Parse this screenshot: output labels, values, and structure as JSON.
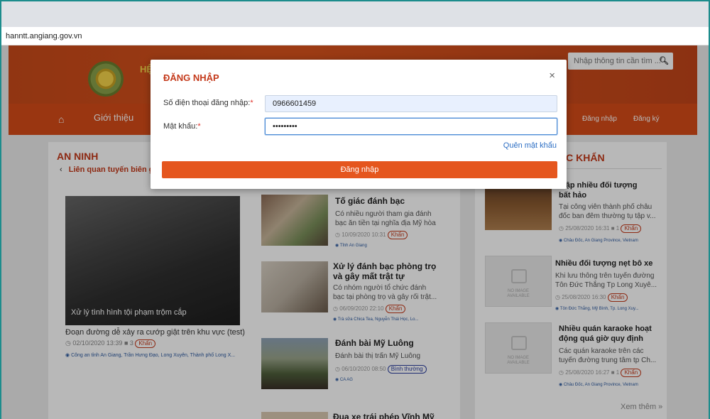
{
  "browser": {
    "url": "hanntt.angiang.gov.vn"
  },
  "header": {
    "title_fragment": "HỆ",
    "search_placeholder": "Nhập thông tin cần tìm ...",
    "search_icon": "search-icon"
  },
  "nav": {
    "home_icon": "home-icon",
    "intro": "Giới thiệu",
    "login": "Đăng nhập",
    "register": "Đăng ký"
  },
  "left": {
    "section": "AN NINH",
    "sub_prev": "‹",
    "sub_label": "Liên quan tuyến biên gi",
    "image_caption": "Xử lý tình hình tội phạm trộm cắp",
    "caption": "Đoạn đường dễ xảy ra cướp giật trên khu vực (test)",
    "meta_time": "02/10/2020 13:39",
    "meta_comments": "3",
    "badge": "Khẩn",
    "location": "Công an tỉnh An Giang, Trần Hưng Đạo, Long Xuyên, Thành phố Long X..."
  },
  "middle": {
    "articles": [
      {
        "title": "Tố giác đánh bạc",
        "desc1": "Có nhiều người tham gia đánh",
        "desc2": "bạc ăn tiền tại nghĩa địa Mỹ hòa",
        "meta": "10/09/2020 10:31",
        "badge": "Khẩn",
        "loc": "Tỉnh An Giang"
      },
      {
        "title": "Xử lý đánh bạc phòng trọ",
        "title2": "và gây mất trật tự",
        "desc1": "Có nhóm người tổ chức đánh",
        "desc2": "bạc tại phòng trọ và gây rối trật...",
        "meta": "06/09/2020 22:10",
        "badge": "Khẩn",
        "loc": "Trà sữa Chica Tea, Nguyễn Thái Học, Lo..."
      },
      {
        "title": "Đánh bài Mỹ Luông",
        "desc1": "Đánh bài thị trấn Mỹ Luông",
        "meta": "06/10/2020 08:50",
        "badge": "Bình thường",
        "loc": "CA AG"
      },
      {
        "title": "Đua xe trái phép Vĩnh Mỹ"
      }
    ]
  },
  "right": {
    "section": "ÁC KHẨN",
    "items": [
      {
        "title1": "i tập nhiều đối tượng",
        "title2": "bất hảo",
        "desc1": "Tại công viên thành phố châu",
        "desc2": "đốc ban đêm thường tụ tập v...",
        "meta": "25/08/2020 16:31",
        "comments": "1",
        "badge": "Khẩn",
        "loc": "Châu Đốc, An Giang Province, Vietnam"
      },
      {
        "title1": "Nhiều đối tượng nẹt bô xe",
        "desc1": "Khi lưu thông trên tuyến đường",
        "desc2": "Tôn Đức Thắng Tp Long Xuyê...",
        "meta": "25/08/2020 16:30",
        "badge": "Khẩn",
        "loc": "Tôn Đức Thắng, Mỹ Bình, Tp. Long Xuy..."
      },
      {
        "title1": "Nhiều quán karaoke hoạt",
        "title2": "động quá giờ quy định",
        "desc1": "Các quán karaoke trên các",
        "desc2": "tuyến đường trung tâm tp Ch...",
        "meta": "25/08/2020 16:27",
        "comments": "1",
        "badge": "Khẩn",
        "loc": "Châu Đốc, An Giang Province, Vietnam"
      }
    ],
    "noimg1": "NO IMAGE",
    "noimg2": "AVAILABLE",
    "more": "Xem thêm »"
  },
  "modal": {
    "title": "ĐĂNG NHẬP",
    "close": "×",
    "phone_label": "Số điện thoại đăng nhập:",
    "password_label": "Mật khẩu:",
    "required_mark": "*",
    "phone_value": "0966601459",
    "password_value": "123456789",
    "forgot": "Quên mật khẩu",
    "submit": "Đăng nhập"
  },
  "colors": {
    "brand": "#d64b18",
    "accent": "#c4391a",
    "link": "#2d6fc4",
    "button": "#e5561e"
  }
}
